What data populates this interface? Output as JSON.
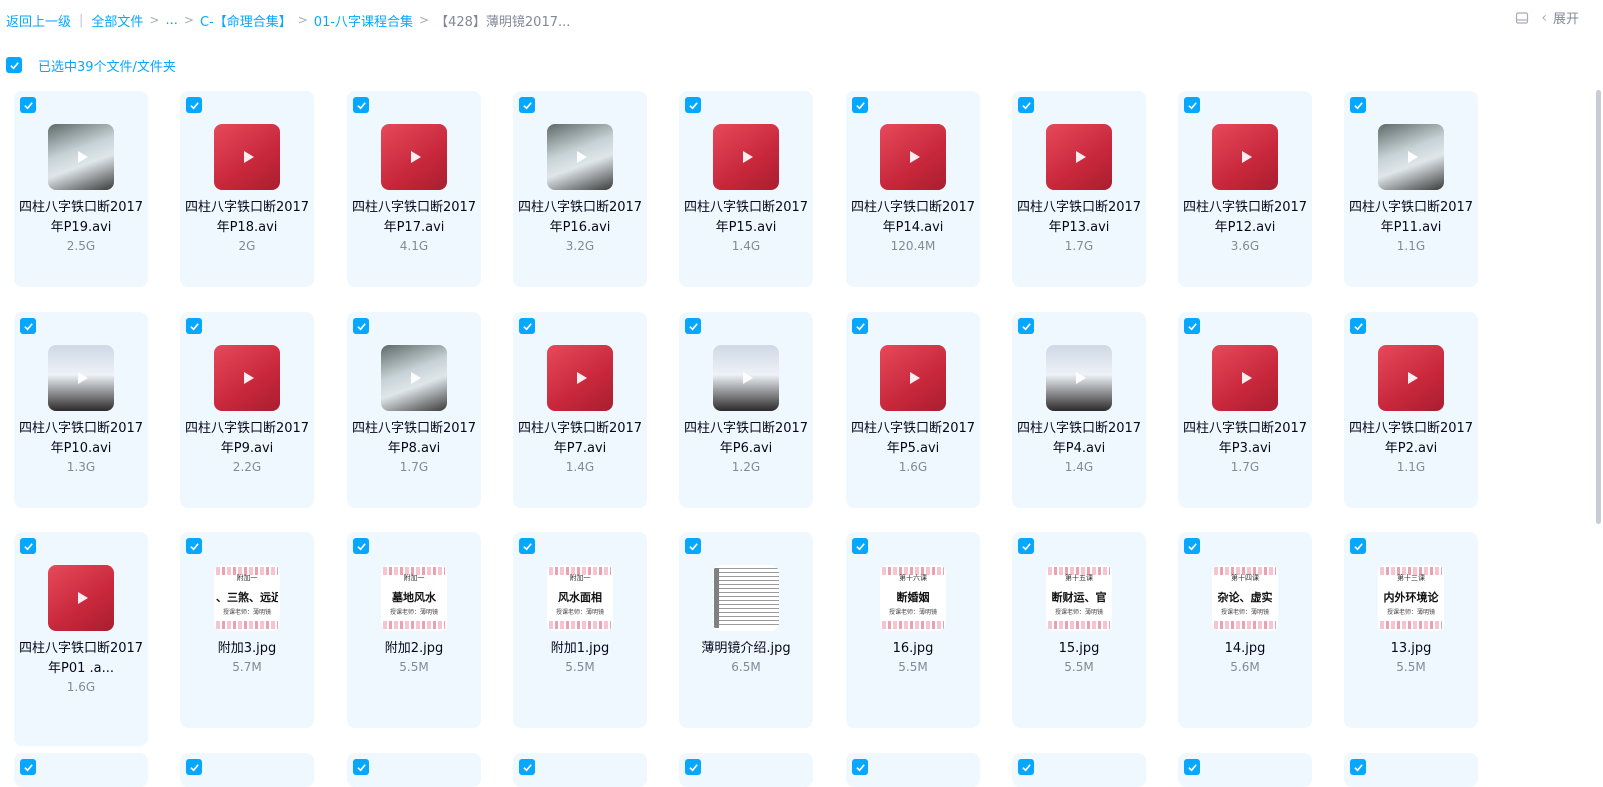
{
  "breadcrumb": {
    "back": "返回上一级",
    "items": [
      "全部文件",
      "...",
      "C-【命理合集】",
      "01-八字课程合集"
    ],
    "current": "【428】薄明镜2017..."
  },
  "toolbar": {
    "expand_label": "展开"
  },
  "selection": {
    "label": "已选中39个文件/文件夹"
  },
  "files": [
    {
      "name": "四柱八字铁口断2017年P19.avi",
      "size": "2.5G",
      "thumb": "classroom"
    },
    {
      "name": "四柱八字铁口断2017年P18.avi",
      "size": "2G",
      "thumb": "video"
    },
    {
      "name": "四柱八字铁口断2017年P17.avi",
      "size": "4.1G",
      "thumb": "video"
    },
    {
      "name": "四柱八字铁口断2017年P16.avi",
      "size": "3.2G",
      "thumb": "classroom"
    },
    {
      "name": "四柱八字铁口断2017年P15.avi",
      "size": "1.4G",
      "thumb": "video"
    },
    {
      "name": "四柱八字铁口断2017年P14.avi",
      "size": "120.4M",
      "thumb": "video"
    },
    {
      "name": "四柱八字铁口断2017年P13.avi",
      "size": "1.7G",
      "thumb": "video"
    },
    {
      "name": "四柱八字铁口断2017年P12.avi",
      "size": "3.6G",
      "thumb": "video"
    },
    {
      "name": "四柱八字铁口断2017年P11.avi",
      "size": "1.1G",
      "thumb": "classroom"
    },
    {
      "name": "四柱八字铁口断2017年P10.avi",
      "size": "1.3G",
      "thumb": "screen"
    },
    {
      "name": "四柱八字铁口断2017年P9.avi",
      "size": "2.2G",
      "thumb": "video"
    },
    {
      "name": "四柱八字铁口断2017年P8.avi",
      "size": "1.7G",
      "thumb": "classroom"
    },
    {
      "name": "四柱八字铁口断2017年P7.avi",
      "size": "1.4G",
      "thumb": "video"
    },
    {
      "name": "四柱八字铁口断2017年P6.avi",
      "size": "1.2G",
      "thumb": "screen"
    },
    {
      "name": "四柱八字铁口断2017年P5.avi",
      "size": "1.6G",
      "thumb": "video"
    },
    {
      "name": "四柱八字铁口断2017年P4.avi",
      "size": "1.4G",
      "thumb": "screen"
    },
    {
      "name": "四柱八字铁口断2017年P3.avi",
      "size": "1.7G",
      "thumb": "video"
    },
    {
      "name": "四柱八字铁口断2017年P2.avi",
      "size": "1.1G",
      "thumb": "video"
    },
    {
      "name": "四柱八字铁口断2017年P01 .a...",
      "size": "1.6G",
      "thumb": "video"
    },
    {
      "name": "附加3.jpg",
      "size": "5.7M",
      "thumb": "poster",
      "poster_top": "附加一",
      "poster_main": "、三煞、远近",
      "poster_sub": "授课老师：薄明镜"
    },
    {
      "name": "附加2.jpg",
      "size": "5.5M",
      "thumb": "poster",
      "poster_top": "附加一",
      "poster_main": "墓地风水",
      "poster_sub": "授课老师：薄明镜"
    },
    {
      "name": "附加1.jpg",
      "size": "5.5M",
      "thumb": "poster",
      "poster_top": "附加一",
      "poster_main": "风水面相",
      "poster_sub": "授课老师：薄明镜"
    },
    {
      "name": "薄明镜介绍.jpg",
      "size": "6.5M",
      "thumb": "doc"
    },
    {
      "name": "16.jpg",
      "size": "5.5M",
      "thumb": "poster",
      "poster_top": "第十六课",
      "poster_main": "断婚姻",
      "poster_sub": "授课老师：薄明镜"
    },
    {
      "name": "15.jpg",
      "size": "5.5M",
      "thumb": "poster",
      "poster_top": "第十五课",
      "poster_main": "断财运、官",
      "poster_sub": "授课老师：薄明镜"
    },
    {
      "name": "14.jpg",
      "size": "5.6M",
      "thumb": "poster",
      "poster_top": "第十四课",
      "poster_main": "杂论、虚实",
      "poster_sub": "授课老师：薄明镜"
    },
    {
      "name": "13.jpg",
      "size": "5.5M",
      "thumb": "poster",
      "poster_top": "第十三课",
      "poster_main": "内外环境论",
      "poster_sub": "授课老师：薄明镜"
    }
  ],
  "colors": {
    "accent": "#06a7ff",
    "card_bg": "#f0f8ff",
    "muted": "#818999",
    "video": "#d6303f"
  }
}
